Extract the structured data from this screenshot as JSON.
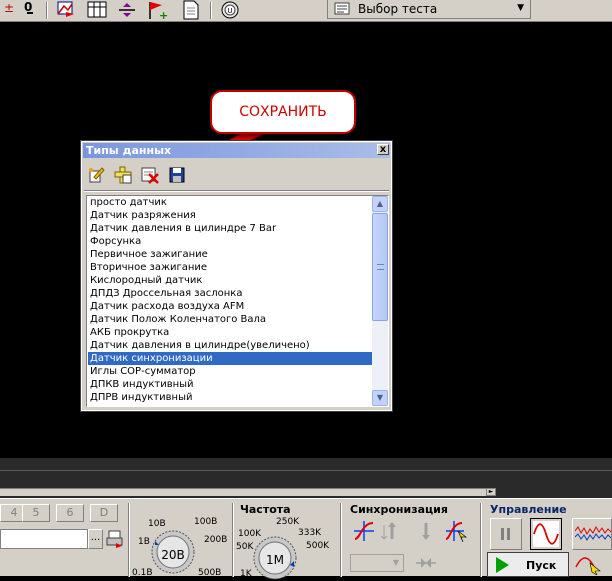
{
  "toolbar": {
    "test_select_value": "Выбор теста",
    "icons": [
      "number-zero-icon",
      "chart-flag-icon",
      "table-icon",
      "divide-icon",
      "flag-add-icon",
      "document-icon",
      "gauge-icon"
    ]
  },
  "callout": {
    "text": "СОХРАНИТЬ"
  },
  "window": {
    "title": "Типы данных",
    "close_glyph": "x",
    "tools": [
      "edit-icon",
      "add-icon",
      "delete-icon",
      "save-icon"
    ],
    "items": [
      "просто датчик",
      "Датчик разряжения",
      "Датчик давления в цилиндре 7 Bar",
      "Форсунка",
      "Первичное зажигание",
      "Вторичное зажигание",
      "Кислородный датчик",
      "ДПДЗ Дроссельная заслонка",
      "Датчик расхода воздуха AFM",
      "Датчик Полож Коленчатого Вала",
      "АКБ прокрутка",
      "Датчик давления в цилиндре(увеличено)",
      "Датчик синхронизации",
      "Иглы СОР-сумматор",
      "ДПКВ индуктивный",
      "ДПРВ индуктивный"
    ],
    "selected_index": 12
  },
  "panel": {
    "channel_buttons": [
      "4",
      "5",
      "6",
      "D"
    ],
    "dots_label": "...",
    "voltage": {
      "ticks": [
        "10B",
        "100B",
        "1B",
        "200B",
        "0.1B",
        "500B"
      ],
      "value": "20B"
    },
    "frequency": {
      "title": "Частота",
      "ticks": [
        "250K",
        "100K",
        "333K",
        "50K",
        "500K",
        "1K"
      ],
      "value": "1M"
    },
    "sync": {
      "title": "Синхронизация"
    },
    "control": {
      "title": "Управление",
      "start_label": "Пуск"
    }
  }
}
